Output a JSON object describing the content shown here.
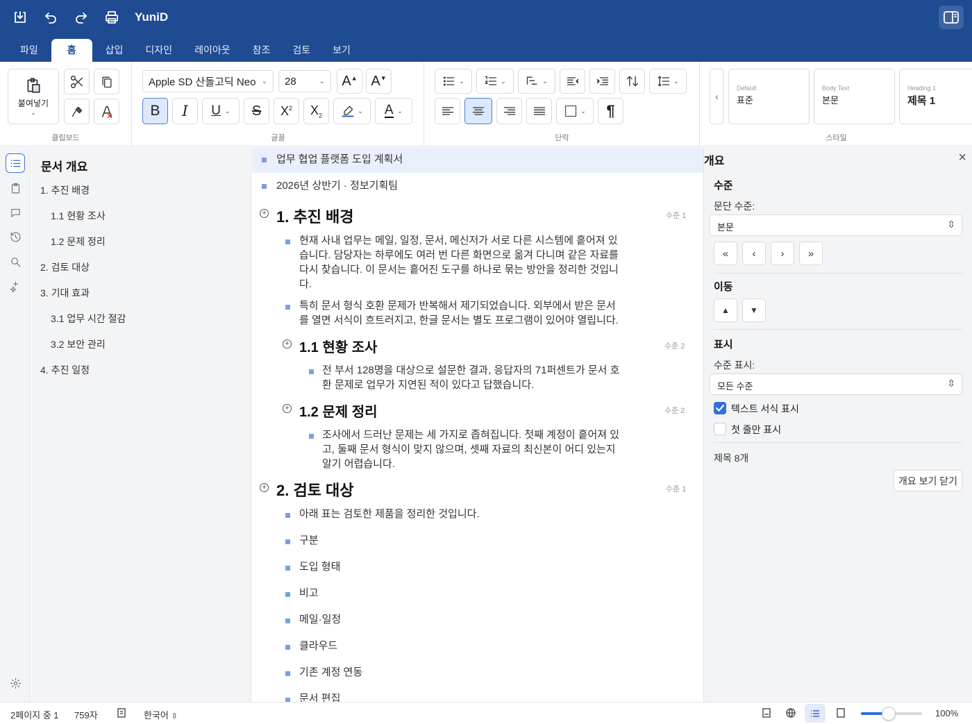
{
  "app": {
    "title": "YuniD"
  },
  "titlebar": {
    "icons": [
      "save-icon",
      "undo-icon",
      "redo-icon",
      "print-icon",
      "sidebar-toggle-icon"
    ]
  },
  "menu": {
    "tabs": [
      "파일",
      "홈",
      "삽입",
      "디자인",
      "레이아웃",
      "참조",
      "검토",
      "보기"
    ],
    "active": "홈"
  },
  "ribbon": {
    "clipboard": {
      "label": "클립보드",
      "paste_label": "붙여넣기"
    },
    "font": {
      "label": "글꼴",
      "family": "Apple SD 산돌고딕 Neo",
      "size": "28"
    },
    "paragraph": {
      "label": "단락"
    },
    "styles": {
      "label": "스타일",
      "cards": [
        {
          "small": "Default",
          "main": "표준"
        },
        {
          "small": "Body Text",
          "main": "본문"
        },
        {
          "small": "Heading 1",
          "main": "제목 1"
        }
      ]
    }
  },
  "nav": {
    "title": "문서 개요",
    "items": [
      "1. 추진 배경",
      "1.1 현황 조사",
      "1.2 문제 정리",
      "2. 검토 대상",
      "3. 기대 효과",
      "3.1 업무 시간 절감",
      "3.2 보안 관리",
      "4. 추진 일정"
    ]
  },
  "doc": {
    "meta": [
      "업무 협업 플랫폼 도입 계획서",
      "2026년 상반기 · 정보기획팀"
    ],
    "h1": {
      "text": "1. 추진 배경",
      "level": "수준 1"
    },
    "p1": [
      "현재 사내 업무는 메일, 일정, 문서, 메신저가 서로 다른 시스템에 흩어져 있",
      "습니다. 담당자는 하루에도 여러 번 다른 화면으로 옮겨 다니며 같은 자료를",
      "다시 찾습니다. 이 문서는 흩어진 도구를 하나로 묶는 방안을 정리한 것입니",
      "다."
    ],
    "p2": [
      "특히 문서 형식 호환 문제가 반복해서 제기되었습니다. 외부에서 받은 문서",
      "를 열면 서식이 흐트러지고, 한글 문서는 별도 프로그램이 있어야 열립니다."
    ],
    "h11": {
      "text": "1.1 현황 조사",
      "level": "수준 2"
    },
    "p3": [
      "전 부서 128명을 대상으로 설문한 결과, 응답자의 71퍼센트가 문서 호",
      "환 문제로 업무가 지연된 적이 있다고 답했습니다."
    ],
    "h12": {
      "text": "1.2 문제 정리",
      "level": "수준 2"
    },
    "p4": [
      "조사에서 드러난 문제는 세 가지로 좁혀집니다. 첫째 계정이 흩어져 있",
      "고, 둘째 문서 형식이 맞지 않으며, 셋째 자료의 최신본이 어디 있는지",
      "알기 어렵습니다."
    ],
    "h2": {
      "text": "2. 검토 대상",
      "level": "수준 1"
    },
    "list": [
      "아래 표는 검토한 제품을 정리한 것입니다.",
      "구분",
      "도입 형태",
      "비고",
      "메일·일정",
      "클라우드",
      "기존 계정 연동",
      "문서 편집"
    ]
  },
  "outline_panel": {
    "title": "개요",
    "level_section": "수준",
    "para_level_label": "문단 수준:",
    "para_level_value": "본문",
    "move_section": "이동",
    "display_section": "표시",
    "show_level_label": "수준 표시:",
    "show_level_value": "모든 수준",
    "check_text_format": "텍스트 서식 표시",
    "check_first_line": "첫 줄만 표시",
    "heading_count": "제목 8개",
    "close_button": "개요 보기 닫기"
  },
  "status": {
    "page": "2페이지 중 1",
    "chars": "759자",
    "language": "한국어",
    "zoom": "100%",
    "zoom_fraction": 0.45
  }
}
